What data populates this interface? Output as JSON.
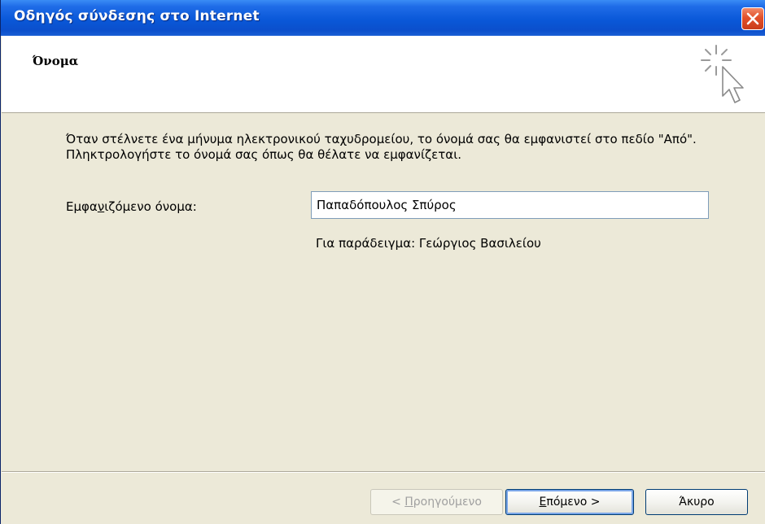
{
  "window": {
    "title": "Οδηγός σύνδεσης στο Internet"
  },
  "header": {
    "title": "Όνομα",
    "icon": "wizard-cursor-icon"
  },
  "content": {
    "description": "Όταν στέλνετε ένα μήνυμα ηλεκτρονικού ταχυδρομείου, το όνομά σας θα εμφανιστεί στο πεδίο \"Από\". Πληκτρολογήστε το όνομά σας όπως θα θέλατε να εμφανίζεται.",
    "display_name_label_pre": "Εμφα",
    "display_name_label_mnemonic": "ν",
    "display_name_label_post": "ιζόμενο όνομα:",
    "display_name_value": "Παπαδόπουλος Σπύρος",
    "example": "Για παράδειγμα: Γεώργιος Βασιλείου"
  },
  "buttons": {
    "back_prefix": "< ",
    "back_mnemonic": "Π",
    "back_rest": "ροηγούμενο",
    "next_mnemonic": "Ε",
    "next_rest": "πόμενο >",
    "cancel": "Άκυρο"
  },
  "colors": {
    "titlebar": "#0a58d8",
    "dialog_bg": "#ece9d8",
    "close_button": "#e2502a"
  }
}
